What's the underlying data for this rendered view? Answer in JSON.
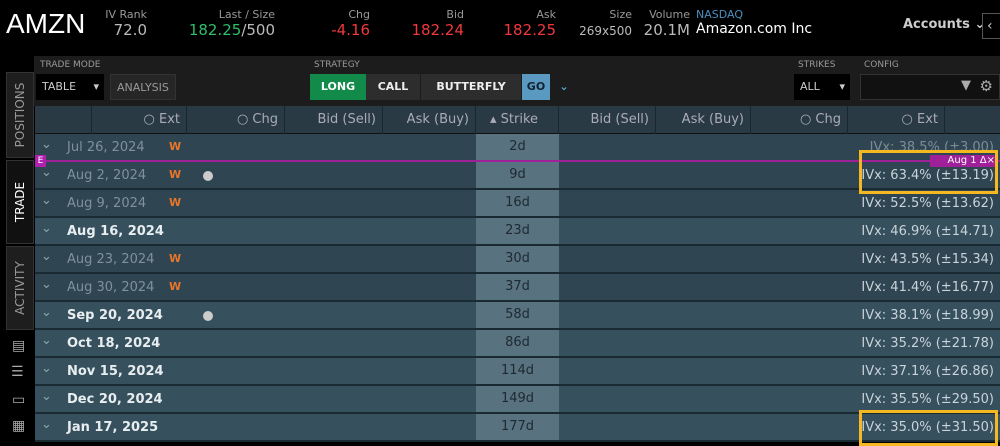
{
  "header": {
    "symbol": "AMZN",
    "iv_rank_label": "IV Rank",
    "iv_rank": "72.0",
    "last_label": "Last / Size",
    "last": "182.25",
    "last_size": "/500",
    "chg_label": "Chg",
    "chg": "-4.16",
    "bid_label": "Bid",
    "bid": "182.24",
    "ask_label": "Ask",
    "ask": "182.25",
    "size_label": "Size",
    "size": "269x500",
    "volume_label": "Volume",
    "volume": "20.1M",
    "exchange": "NASDAQ",
    "company": "Amazon.com Inc",
    "accounts": "Accounts"
  },
  "toolbar": {
    "trade_mode_label": "TRADE MODE",
    "trade_mode": "TABLE",
    "analysis": "ANALYSIS",
    "strategy_label": "STRATEGY",
    "long": "LONG",
    "call": "CALL",
    "butterfly": "BUTTERFLY",
    "go": "GO",
    "strikes_label": "STRIKES",
    "strikes": "ALL",
    "config_label": "CONFIG"
  },
  "sidebar": {
    "positions": "POSITIONS",
    "trade": "TRADE",
    "activity": "ACTIVITY"
  },
  "columns": [
    "Ext",
    "Chg",
    "Bid (Sell)",
    "Ask (Buy)",
    "Strike",
    "Bid (Sell)",
    "Ask (Buy)",
    "Chg",
    "Ext"
  ],
  "earnings": {
    "marker": "E",
    "label": "Aug 1 Δ×"
  },
  "rows": [
    {
      "date": "Jul 26, 2024",
      "weekly": "W",
      "dot": false,
      "days": "2d",
      "ivx": "IVx: 38.5% (±3.00)",
      "type": "w"
    },
    {
      "date": "Aug 2, 2024",
      "weekly": "W",
      "dot": true,
      "days": "9d",
      "ivx": "IVx: 63.4% (±13.19)",
      "type": "w"
    },
    {
      "date": "Aug 9, 2024",
      "weekly": "W",
      "dot": false,
      "days": "16d",
      "ivx": "IVx: 52.5% (±13.62)",
      "type": "w"
    },
    {
      "date": "Aug 16, 2024",
      "weekly": "",
      "dot": false,
      "days": "23d",
      "ivx": "IVx: 46.9% (±14.71)",
      "type": "m"
    },
    {
      "date": "Aug 23, 2024",
      "weekly": "W",
      "dot": false,
      "days": "30d",
      "ivx": "IVx: 43.5% (±15.34)",
      "type": "w"
    },
    {
      "date": "Aug 30, 2024",
      "weekly": "W",
      "dot": false,
      "days": "37d",
      "ivx": "IVx: 41.4% (±16.77)",
      "type": "w"
    },
    {
      "date": "Sep 20, 2024",
      "weekly": "",
      "dot": true,
      "days": "58d",
      "ivx": "IVx: 38.1% (±18.99)",
      "type": "m"
    },
    {
      "date": "Oct 18, 2024",
      "weekly": "",
      "dot": false,
      "days": "86d",
      "ivx": "IVx: 35.2% (±21.78)",
      "type": "m"
    },
    {
      "date": "Nov 15, 2024",
      "weekly": "",
      "dot": false,
      "days": "114d",
      "ivx": "IVx: 37.1% (±26.86)",
      "type": "m"
    },
    {
      "date": "Dec 20, 2024",
      "weekly": "",
      "dot": false,
      "days": "149d",
      "ivx": "IVx: 35.5% (±29.50)",
      "type": "m"
    },
    {
      "date": "Jan 17, 2025",
      "weekly": "",
      "dot": false,
      "days": "177d",
      "ivx": "IVx: 35.0% (±31.50)",
      "type": "m"
    }
  ]
}
